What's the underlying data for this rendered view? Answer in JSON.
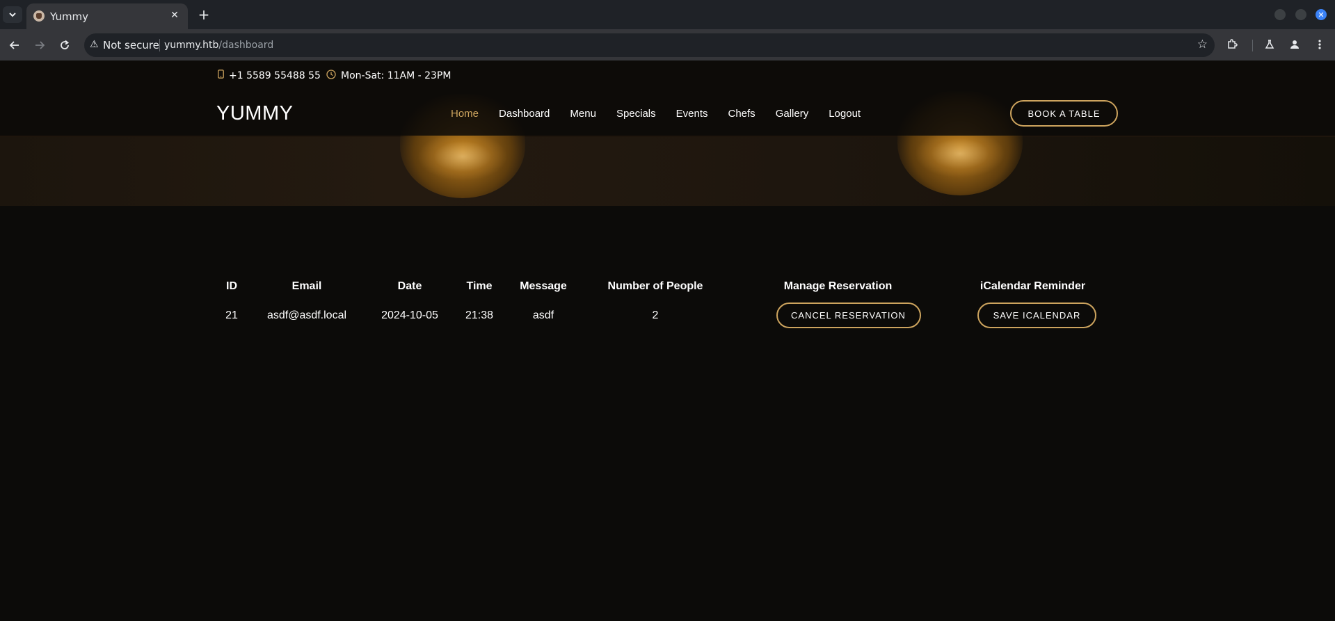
{
  "browser": {
    "tab_title": "Yummy",
    "security_label": "Not secure",
    "url_host": "yummy.htb",
    "url_path": "/dashboard"
  },
  "topbar": {
    "phone": "+1 5589 55488 55",
    "hours": "Mon-Sat: 11AM - 23PM"
  },
  "header": {
    "logo": "YUMMY",
    "menu": [
      "Home",
      "Dashboard",
      "Menu",
      "Specials",
      "Events",
      "Chefs",
      "Gallery",
      "Logout"
    ],
    "active_menu": "Home",
    "book_button": "BOOK A TABLE"
  },
  "reservations": {
    "columns": [
      "ID",
      "Email",
      "Date",
      "Time",
      "Message",
      "Number of People",
      "Manage Reservation",
      "iCalendar Reminder"
    ],
    "rows": [
      {
        "id": "21",
        "email": "asdf@asdf.local",
        "date": "2024-10-05",
        "time": "21:38",
        "message": "asdf",
        "people": "2",
        "cancel_label": "CANCEL RESERVATION",
        "ical_label": "SAVE ICALENDAR"
      }
    ]
  },
  "colors": {
    "accent": "#cda45e",
    "background": "#0c0b09"
  }
}
